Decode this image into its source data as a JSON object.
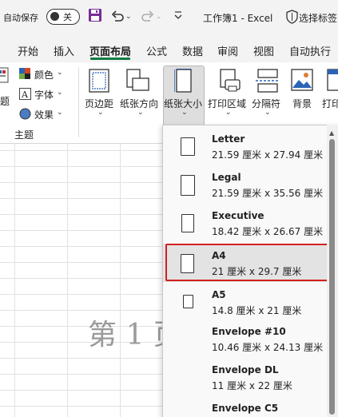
{
  "titlebar": {
    "autosave_label": "自动保存",
    "autosave_state": "关",
    "doc_title": "工作簿1 - Excel",
    "search_label": "选择标签"
  },
  "tabs": [
    {
      "label": "开始"
    },
    {
      "label": "插入"
    },
    {
      "label": "页面布局",
      "active": true
    },
    {
      "label": "公式"
    },
    {
      "label": "数据"
    },
    {
      "label": "审阅"
    },
    {
      "label": "视图"
    },
    {
      "label": "自动执行"
    }
  ],
  "ribbon": {
    "themes_partial": "题",
    "colors": "颜色",
    "fonts": "字体",
    "effects": "效果",
    "group_label": "主题",
    "margins": "页边距",
    "orientation": "纸张方向",
    "size": "纸张大小",
    "print_area": "打印区域",
    "breaks": "分隔符",
    "background": "背景",
    "print_titles_partial": "打印"
  },
  "sheet": {
    "page_watermark": "第 1 页"
  },
  "paper_sizes": [
    {
      "name": "Letter",
      "dims": "21.59 厘米 x 27.94 厘米"
    },
    {
      "name": "Legal",
      "dims": "21.59 厘米 x 35.56 厘米"
    },
    {
      "name": "Executive",
      "dims": "18.42 厘米 x 26.67 厘米"
    },
    {
      "name": "A4",
      "dims": "21 厘米 x 29.7 厘米",
      "selected": true
    },
    {
      "name": "A5",
      "dims": "14.8 厘米 x 21 厘米"
    },
    {
      "name": "Envelope #10",
      "dims": "10.46 厘米 x 24.13 厘米"
    },
    {
      "name": "Envelope DL",
      "dims": "11 厘米 x 22 厘米"
    },
    {
      "name": "Envelope C5",
      "dims": ""
    }
  ],
  "colors": {
    "accent_green": "#107c41",
    "save_purple": "#7a2a96",
    "highlight_red": "#d21f1f"
  }
}
